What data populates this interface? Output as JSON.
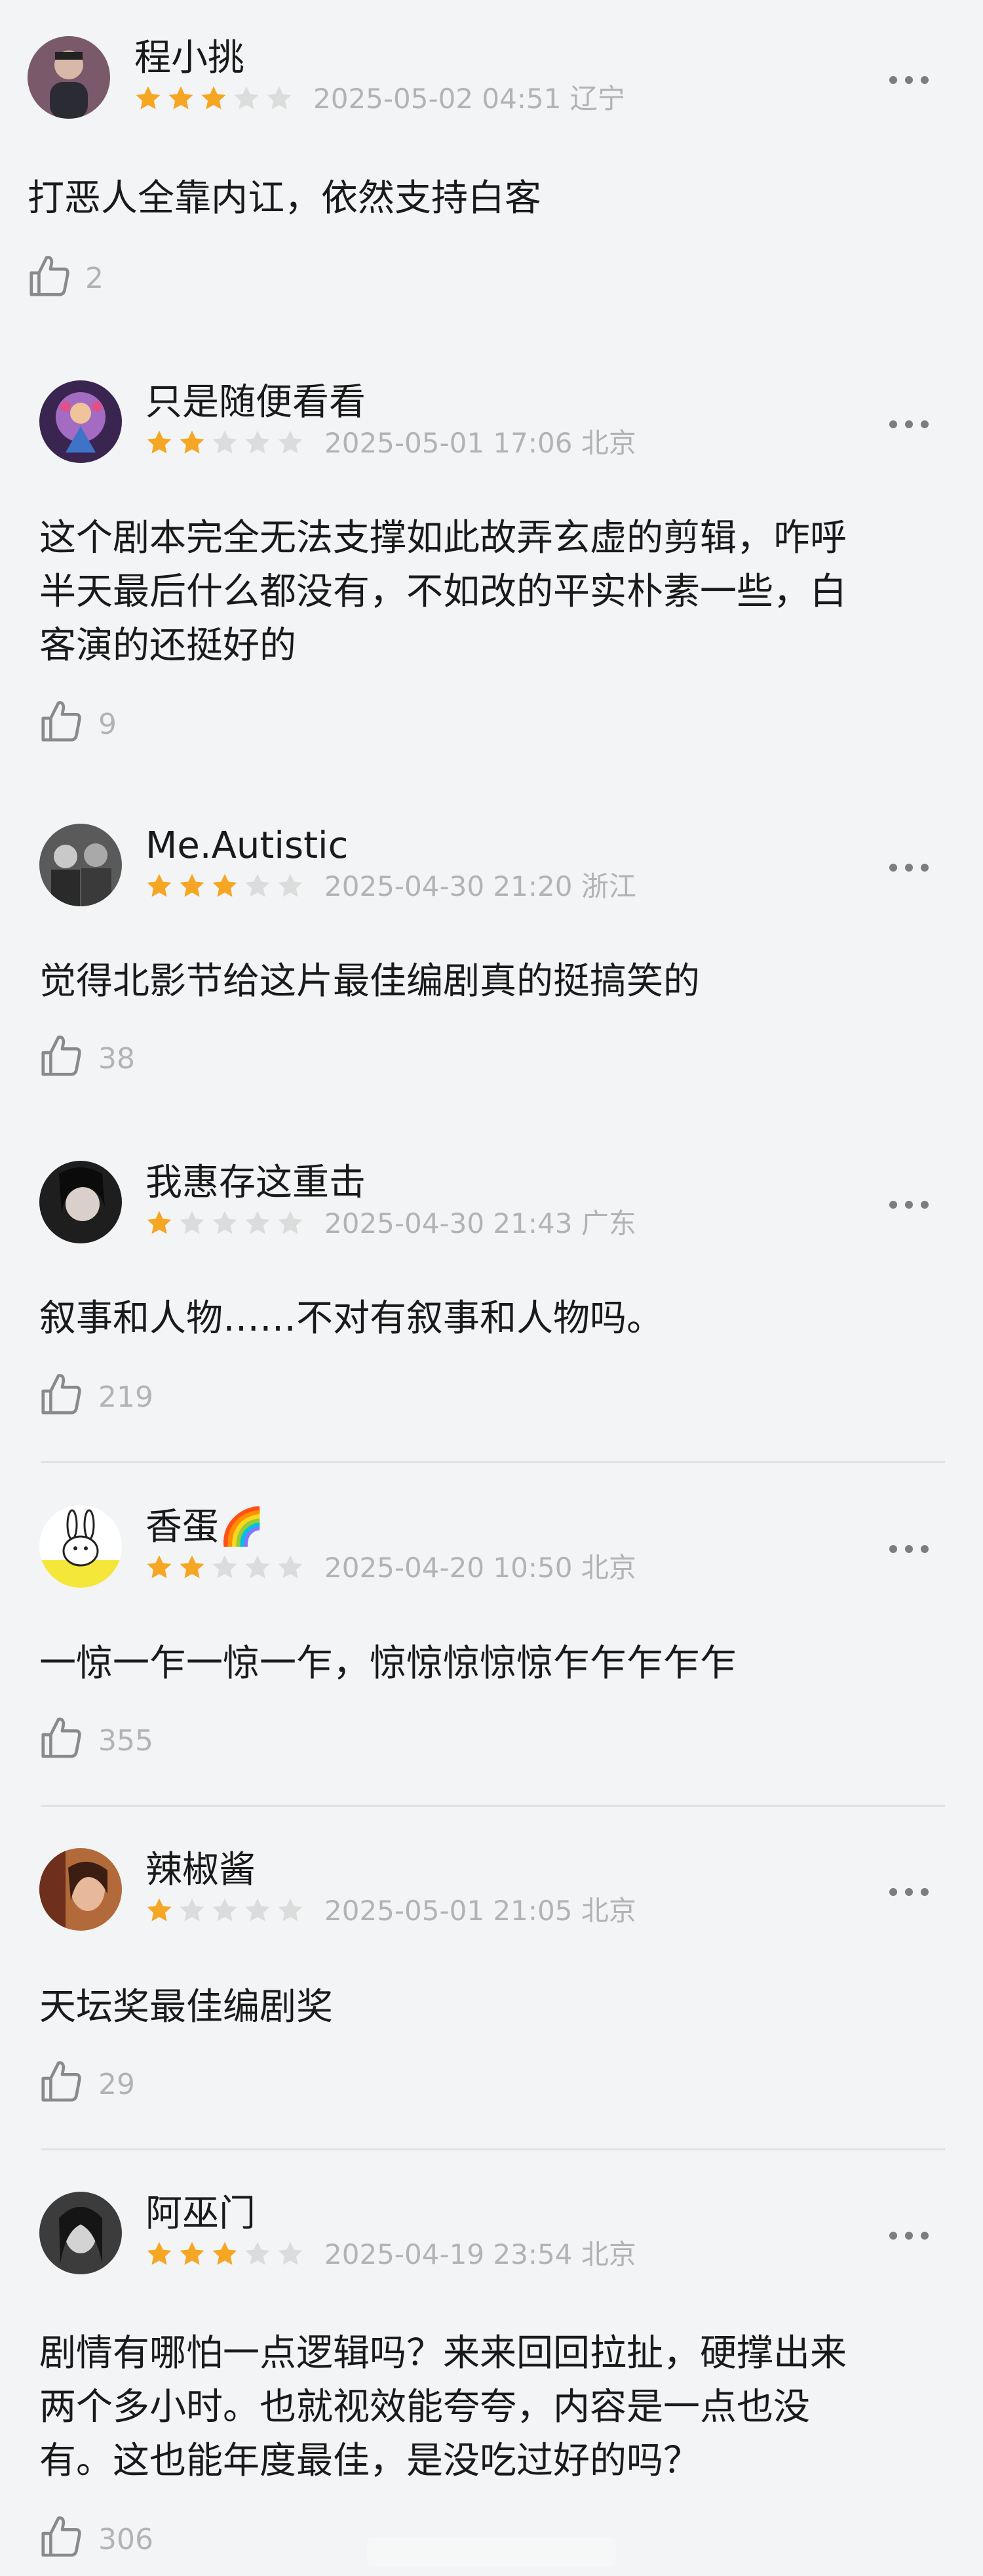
{
  "reviews": [
    {
      "user": "程小挑",
      "rating": 3,
      "date": "2025-05-02 04:51",
      "location": "辽宁",
      "lines": [
        "打恶人全靠内讧，依然支持白客"
      ],
      "likes": "2",
      "avatar": "person-dark-avatar"
    },
    {
      "user": "只是随便看看",
      "rating": 2,
      "date": "2025-05-01 17:06",
      "location": "北京",
      "lines": [
        "这个剧本完全无法支撑如此故弄玄虚的剪辑，咋呼",
        "半天最后什么都没有，不如改的平实朴素一些，白",
        "客演的还挺好的"
      ],
      "likes": "9",
      "avatar": "purple-illustration-avatar"
    },
    {
      "user": "Me.Autistic",
      "rating": 3,
      "date": "2025-04-30 21:20",
      "location": "浙江",
      "lines": [
        "觉得北影节给这片最佳编剧真的挺搞笑的"
      ],
      "likes": "38",
      "avatar": "group-bw-avatar"
    },
    {
      "user": "我惠存这重击",
      "rating": 1,
      "date": "2025-04-30 21:43",
      "location": "广东",
      "lines": [
        "叙事和人物……不对有叙事和人物吗。"
      ],
      "likes": "219",
      "avatar": "woman-dark-avatar"
    },
    {
      "user": "香蛋🌈",
      "rating": 2,
      "date": "2025-04-20 10:50",
      "location": "北京",
      "lines": [
        "一惊一乍一惊一乍，惊惊惊惊惊乍乍乍乍乍"
      ],
      "likes": "355",
      "avatar": "rabbit-avatar"
    },
    {
      "user": "辣椒酱",
      "rating": 1,
      "date": "2025-05-01 21:05",
      "location": "北京",
      "lines": [
        "天坛奖最佳编剧奖"
      ],
      "likes": "29",
      "avatar": "portrait-warm-avatar"
    },
    {
      "user": "阿巫门",
      "rating": 3,
      "date": "2025-04-19 23:54",
      "location": "北京",
      "lines": [
        "剧情有哪怕一点逻辑吗？来来回回拉扯，硬撑出来",
        "两个多小时。也就视效能夸夸，内容是一点也没",
        "有。这也能年度最佳，是没吃过好的吗？"
      ],
      "likes": "306",
      "avatar": "woman-bw-avatar"
    }
  ],
  "colors": {
    "star_on": "#f5a623",
    "star_off": "#dcdcdc",
    "meta": "#b3b3b3"
  }
}
